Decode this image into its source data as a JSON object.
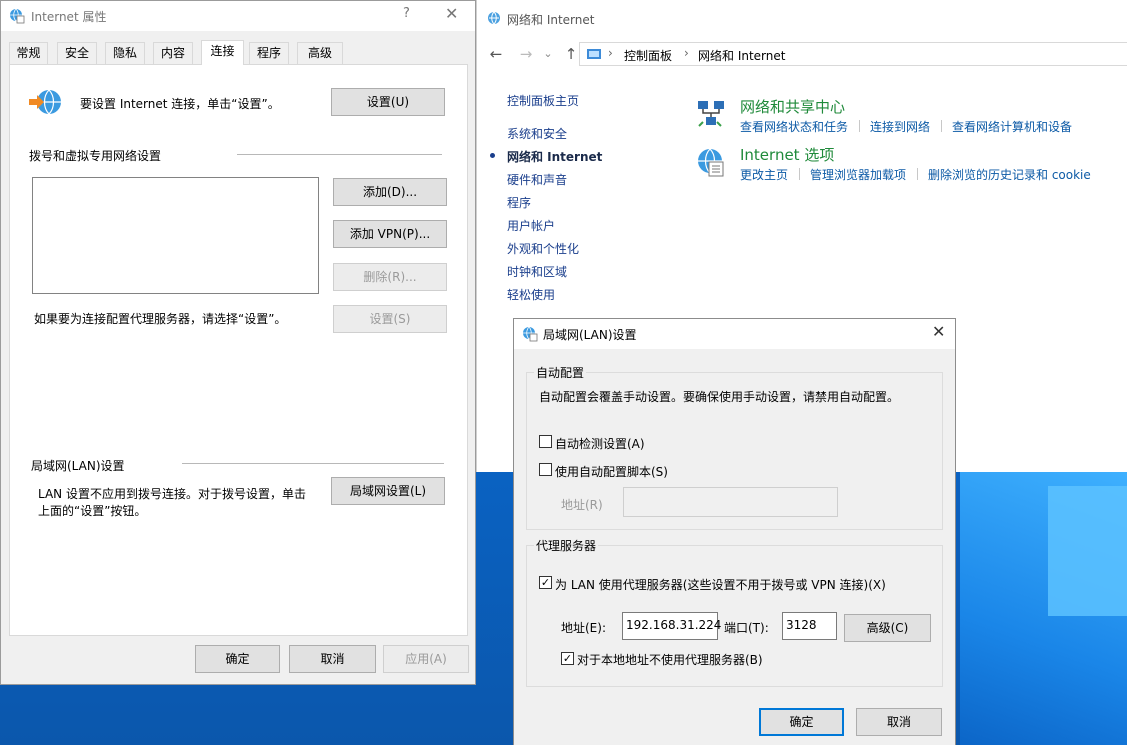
{
  "control_panel": {
    "window_title": "网络和 Internet",
    "breadcrumb": [
      "控制面板",
      "网络和 Internet"
    ],
    "sidebar": {
      "home": "控制面板主页",
      "items": [
        "系统和安全",
        "网络和 Internet",
        "硬件和声音",
        "程序",
        "用户帐户",
        "外观和个性化",
        "时钟和区域",
        "轻松使用"
      ],
      "active_index": 1
    },
    "categories": [
      {
        "title": "网络和共享中心",
        "links": [
          "查看网络状态和任务",
          "连接到网络",
          "查看网络计算机和设备"
        ]
      },
      {
        "title": "Internet 选项",
        "links": [
          "更改主页",
          "管理浏览器加载项",
          "删除浏览的历史记录和 cookie"
        ]
      }
    ]
  },
  "internet_properties": {
    "title": "Internet 属性",
    "help": "?",
    "tabs": [
      "常规",
      "安全",
      "隐私",
      "内容",
      "连接",
      "程序",
      "高级"
    ],
    "selected_tab": 4,
    "setup_text": "要设置 Internet 连接，单击“设置”。",
    "setup_button": "设置(U)",
    "dial_section": "拨号和虚拟专用网络设置",
    "add_button": "添加(D)...",
    "add_vpn_button": "添加 VPN(P)...",
    "delete_button": "删除(R)...",
    "settings_button": "设置(S)",
    "proxy_hint": "如果要为连接配置代理服务器，请选择“设置”。",
    "lan_section": "局域网(LAN)设置",
    "lan_text_1": "LAN 设置不应用到拨号连接。对于拨号设置，单击",
    "lan_text_2": "上面的“设置”按钮。",
    "lan_button": "局域网设置(L)",
    "ok": "确定",
    "cancel": "取消",
    "apply": "应用(A)"
  },
  "lan_settings": {
    "title": "局域网(LAN)设置",
    "auto_group": "自动配置",
    "auto_desc": "自动配置会覆盖手动设置。要确保使用手动设置，请禁用自动配置。",
    "auto_detect": "自动检测设置(A)",
    "auto_detect_checked": false,
    "use_script": "使用自动配置脚本(S)",
    "use_script_checked": false,
    "script_addr_label": "地址(R)",
    "script_addr_value": "",
    "proxy_group": "代理服务器",
    "use_proxy": "为 LAN 使用代理服务器(这些设置不用于拨号或 VPN 连接)(X)",
    "use_proxy_checked": true,
    "addr_label": "地址(E):",
    "addr_value": "192.168.31.224",
    "port_label": "端口(T):",
    "port_value": "3128",
    "advanced_button": "高级(C)",
    "bypass_local": "对于本地地址不使用代理服务器(B)",
    "bypass_local_checked": true,
    "ok": "确定",
    "cancel": "取消"
  }
}
